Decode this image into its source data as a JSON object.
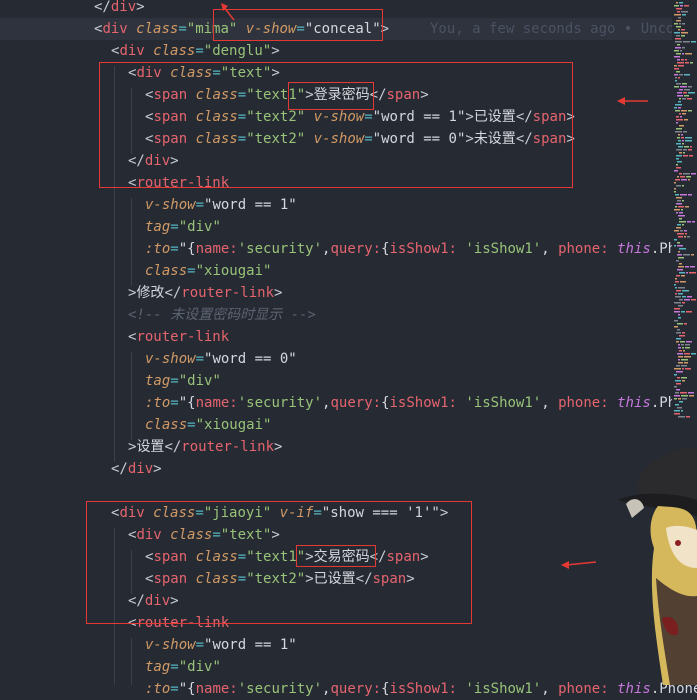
{
  "editor": {
    "blame": "You, a few seconds ago • Uncommitted changes",
    "lines": [
      [
        [
          "</",
          "t-punct"
        ],
        [
          "div",
          "t-tag"
        ],
        [
          ">",
          "t-punct"
        ]
      ],
      [
        [
          "<",
          "t-punct"
        ],
        [
          "div",
          "t-tag"
        ],
        [
          " ",
          "t-text"
        ],
        [
          "class",
          "t-attr"
        ],
        [
          "=",
          "t-eq"
        ],
        [
          "\"mima\"",
          "t-str"
        ],
        [
          " ",
          "t-text"
        ],
        [
          "v-show",
          "t-attr"
        ],
        [
          "=",
          "t-eq"
        ],
        [
          "\"conceal\"",
          "t-text"
        ],
        [
          ">",
          "t-punct"
        ]
      ],
      [
        [
          "<",
          "t-punct"
        ],
        [
          "div",
          "t-tag"
        ],
        [
          " ",
          "t-text"
        ],
        [
          "class",
          "t-attr"
        ],
        [
          "=",
          "t-eq"
        ],
        [
          "\"denglu\"",
          "t-str"
        ],
        [
          ">",
          "t-punct"
        ]
      ],
      [
        [
          "<",
          "t-punct"
        ],
        [
          "div",
          "t-tag"
        ],
        [
          " ",
          "t-text"
        ],
        [
          "class",
          "t-attr"
        ],
        [
          "=",
          "t-eq"
        ],
        [
          "\"text\"",
          "t-str"
        ],
        [
          ">",
          "t-punct"
        ]
      ],
      [
        [
          "<",
          "t-punct"
        ],
        [
          "span",
          "t-tag"
        ],
        [
          " ",
          "t-text"
        ],
        [
          "class",
          "t-attr"
        ],
        [
          "=",
          "t-eq"
        ],
        [
          "\"text1\"",
          "t-str"
        ],
        [
          ">",
          "t-punct"
        ],
        [
          "登录密码",
          "t-text"
        ],
        [
          "</",
          "t-punct"
        ],
        [
          "span",
          "t-tag"
        ],
        [
          ">",
          "t-punct"
        ]
      ],
      [
        [
          "<",
          "t-punct"
        ],
        [
          "span",
          "t-tag"
        ],
        [
          " ",
          "t-text"
        ],
        [
          "class",
          "t-attr"
        ],
        [
          "=",
          "t-eq"
        ],
        [
          "\"text2\"",
          "t-str"
        ],
        [
          " ",
          "t-text"
        ],
        [
          "v-show",
          "t-attr"
        ],
        [
          "=",
          "t-eq"
        ],
        [
          "\"word == 1\"",
          "t-text"
        ],
        [
          ">",
          "t-punct"
        ],
        [
          "已设置",
          "t-text"
        ],
        [
          "</",
          "t-punct"
        ],
        [
          "span",
          "t-tag"
        ],
        [
          ">",
          "t-punct"
        ]
      ],
      [
        [
          "<",
          "t-punct"
        ],
        [
          "span",
          "t-tag"
        ],
        [
          " ",
          "t-text"
        ],
        [
          "class",
          "t-attr"
        ],
        [
          "=",
          "t-eq"
        ],
        [
          "\"text2\"",
          "t-str"
        ],
        [
          " ",
          "t-text"
        ],
        [
          "v-show",
          "t-attr"
        ],
        [
          "=",
          "t-eq"
        ],
        [
          "\"word == 0\"",
          "t-text"
        ],
        [
          ">",
          "t-punct"
        ],
        [
          "未设置",
          "t-text"
        ],
        [
          "</",
          "t-punct"
        ],
        [
          "span",
          "t-tag"
        ],
        [
          ">",
          "t-punct"
        ]
      ],
      [
        [
          "</",
          "t-punct"
        ],
        [
          "div",
          "t-tag"
        ],
        [
          ">",
          "t-punct"
        ]
      ],
      [
        [
          "<",
          "t-punct"
        ],
        [
          "router-link",
          "t-tag"
        ]
      ],
      [
        [
          "v-show",
          "t-attr"
        ],
        [
          "=",
          "t-eq"
        ],
        [
          "\"word == 1\"",
          "t-text"
        ]
      ],
      [
        [
          "tag",
          "t-attr"
        ],
        [
          "=",
          "t-eq"
        ],
        [
          "\"div\"",
          "t-str"
        ]
      ],
      [
        [
          ":to",
          "t-attr"
        ],
        [
          "=",
          "t-eq"
        ],
        [
          "\"{",
          "t-text"
        ],
        [
          "name:",
          "t-tag"
        ],
        [
          "'security'",
          "t-str"
        ],
        [
          ",",
          "t-text"
        ],
        [
          "query:",
          "t-tag"
        ],
        [
          "{",
          "t-text"
        ],
        [
          "isShow1: ",
          "t-tag"
        ],
        [
          "'isShow1'",
          "t-str"
        ],
        [
          ", ",
          "t-text"
        ],
        [
          "phone: ",
          "t-tag"
        ],
        [
          "this",
          "t-kw"
        ],
        [
          ".Phone",
          "t-text"
        ]
      ],
      [
        [
          "class",
          "t-attr"
        ],
        [
          "=",
          "t-eq"
        ],
        [
          "\"xiougai\"",
          "t-str"
        ]
      ],
      [
        [
          ">",
          "t-punct"
        ],
        [
          "修改",
          "t-text"
        ],
        [
          "</",
          "t-punct"
        ],
        [
          "router-link",
          "t-tag"
        ],
        [
          ">",
          "t-punct"
        ]
      ],
      [
        [
          "<!-- 未设置密码时显示 -->",
          "t-cm"
        ]
      ],
      [
        [
          "<",
          "t-punct"
        ],
        [
          "router-link",
          "t-tag"
        ]
      ],
      [
        [
          "v-show",
          "t-attr"
        ],
        [
          "=",
          "t-eq"
        ],
        [
          "\"word == 0\"",
          "t-text"
        ]
      ],
      [
        [
          "tag",
          "t-attr"
        ],
        [
          "=",
          "t-eq"
        ],
        [
          "\"div\"",
          "t-str"
        ]
      ],
      [
        [
          ":to",
          "t-attr"
        ],
        [
          "=",
          "t-eq"
        ],
        [
          "\"{",
          "t-text"
        ],
        [
          "name:",
          "t-tag"
        ],
        [
          "'security'",
          "t-str"
        ],
        [
          ",",
          "t-text"
        ],
        [
          "query:",
          "t-tag"
        ],
        [
          "{",
          "t-text"
        ],
        [
          "isShow1: ",
          "t-tag"
        ],
        [
          "'isShow1'",
          "t-str"
        ],
        [
          ", ",
          "t-text"
        ],
        [
          "phone: ",
          "t-tag"
        ],
        [
          "this",
          "t-kw"
        ],
        [
          ".Phone",
          "t-text"
        ]
      ],
      [
        [
          "class",
          "t-attr"
        ],
        [
          "=",
          "t-eq"
        ],
        [
          "\"xiougai\"",
          "t-str"
        ]
      ],
      [
        [
          ">",
          "t-punct"
        ],
        [
          "设置",
          "t-text"
        ],
        [
          "</",
          "t-punct"
        ],
        [
          "router-link",
          "t-tag"
        ],
        [
          ">",
          "t-punct"
        ]
      ],
      [
        [
          "</",
          "t-punct"
        ],
        [
          "div",
          "t-tag"
        ],
        [
          ">",
          "t-punct"
        ]
      ],
      [],
      [
        [
          "<",
          "t-punct"
        ],
        [
          "div",
          "t-tag"
        ],
        [
          " ",
          "t-text"
        ],
        [
          "class",
          "t-attr"
        ],
        [
          "=",
          "t-eq"
        ],
        [
          "\"jiaoyi\"",
          "t-str"
        ],
        [
          " ",
          "t-text"
        ],
        [
          "v-if",
          "t-attr"
        ],
        [
          "=",
          "t-eq"
        ],
        [
          "\"show === '1'\"",
          "t-text"
        ],
        [
          ">",
          "t-punct"
        ]
      ],
      [
        [
          "<",
          "t-punct"
        ],
        [
          "div",
          "t-tag"
        ],
        [
          " ",
          "t-text"
        ],
        [
          "class",
          "t-attr"
        ],
        [
          "=",
          "t-eq"
        ],
        [
          "\"text\"",
          "t-str"
        ],
        [
          ">",
          "t-punct"
        ]
      ],
      [
        [
          "<",
          "t-punct"
        ],
        [
          "span",
          "t-tag"
        ],
        [
          " ",
          "t-text"
        ],
        [
          "class",
          "t-attr"
        ],
        [
          "=",
          "t-eq"
        ],
        [
          "\"text1\"",
          "t-str"
        ],
        [
          ">",
          "t-punct"
        ],
        [
          "交易密码",
          "t-text"
        ],
        [
          "</",
          "t-punct"
        ],
        [
          "span",
          "t-tag"
        ],
        [
          ">",
          "t-punct"
        ]
      ],
      [
        [
          "<",
          "t-punct"
        ],
        [
          "span",
          "t-tag"
        ],
        [
          " ",
          "t-text"
        ],
        [
          "class",
          "t-attr"
        ],
        [
          "=",
          "t-eq"
        ],
        [
          "\"text2\"",
          "t-str"
        ],
        [
          ">",
          "t-punct"
        ],
        [
          "已设置",
          "t-text"
        ],
        [
          "</",
          "t-punct"
        ],
        [
          "span",
          "t-tag"
        ],
        [
          ">",
          "t-punct"
        ]
      ],
      [
        [
          "</",
          "t-punct"
        ],
        [
          "div",
          "t-tag"
        ],
        [
          ">",
          "t-punct"
        ]
      ],
      [
        [
          "<",
          "t-punct"
        ],
        [
          "router-link",
          "t-tag"
        ]
      ],
      [
        [
          "v-show",
          "t-attr"
        ],
        [
          "=",
          "t-eq"
        ],
        [
          "\"word == 1\"",
          "t-text"
        ]
      ],
      [
        [
          "tag",
          "t-attr"
        ],
        [
          "=",
          "t-eq"
        ],
        [
          "\"div\"",
          "t-str"
        ]
      ],
      [
        [
          ":to",
          "t-attr"
        ],
        [
          "=",
          "t-eq"
        ],
        [
          "\"{",
          "t-text"
        ],
        [
          "name:",
          "t-tag"
        ],
        [
          "'security'",
          "t-str"
        ],
        [
          ",",
          "t-text"
        ],
        [
          "query:",
          "t-tag"
        ],
        [
          "{",
          "t-text"
        ],
        [
          "isShow1: ",
          "t-tag"
        ],
        [
          "'isShow1'",
          "t-str"
        ],
        [
          ", ",
          "t-text"
        ],
        [
          "phone: ",
          "t-tag"
        ],
        [
          "this",
          "t-kw"
        ],
        [
          ".Phone",
          "t-text"
        ]
      ]
    ]
  },
  "colors": {
    "background": "#262a33",
    "annotation": "#e53935"
  }
}
